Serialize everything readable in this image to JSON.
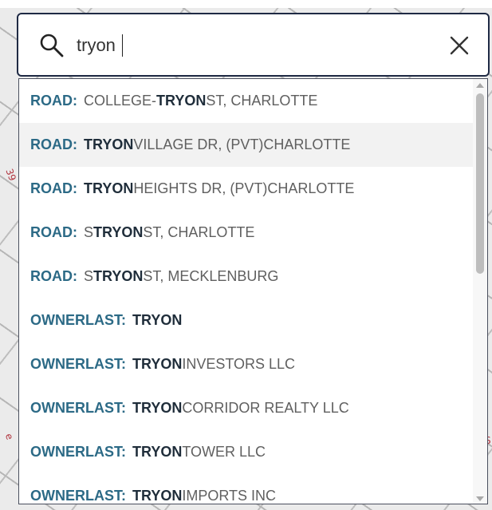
{
  "search": {
    "value": "tryon",
    "clear_icon": "close-icon",
    "search_icon": "search-icon"
  },
  "suggestions": [
    {
      "category": "ROAD:",
      "match": "TRYON",
      "prefix": "COLLEGE-",
      "suffix": " ST, CHARLOTTE"
    },
    {
      "category": "ROAD:",
      "match": "TRYON",
      "prefix": "",
      "suffix": " VILLAGE DR, (PVT)CHARLOTTE"
    },
    {
      "category": "ROAD:",
      "match": "TRYON",
      "prefix": "",
      "suffix": " HEIGHTS DR, (PVT)CHARLOTTE"
    },
    {
      "category": "ROAD:",
      "match": "TRYON",
      "prefix": "S ",
      "suffix": " ST, CHARLOTTE"
    },
    {
      "category": "ROAD:",
      "match": "TRYON",
      "prefix": "S ",
      "suffix": " ST, MECKLENBURG"
    },
    {
      "category": "OWNERLAST:",
      "match": "TRYON",
      "prefix": "",
      "suffix": ""
    },
    {
      "category": "OWNERLAST:",
      "match": "TRYON",
      "prefix": "",
      "suffix": " INVESTORS LLC"
    },
    {
      "category": "OWNERLAST:",
      "match": "TRYON",
      "prefix": "",
      "suffix": " CORRIDOR REALTY LLC"
    },
    {
      "category": "OWNERLAST:",
      "match": "TRYON",
      "prefix": "",
      "suffix": " TOWER LLC"
    },
    {
      "category": "OWNERLAST:",
      "match": "TRYON",
      "prefix": "",
      "suffix": " IMPORTS INC"
    }
  ],
  "highlighted_index": 1,
  "map_labels": [
    "39",
    "e",
    "S"
  ],
  "colors": {
    "category": "#2c6a86",
    "match": "#1f2d3a",
    "border": "#1f2a44",
    "highlight": "#f2f2f2"
  }
}
